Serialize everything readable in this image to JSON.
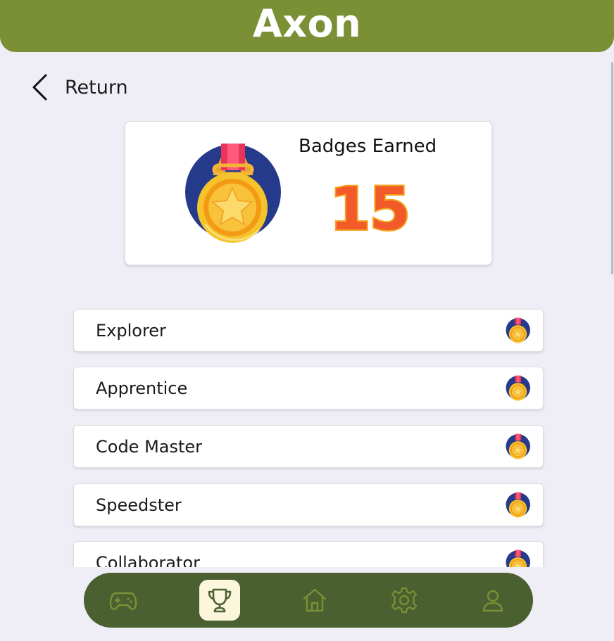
{
  "app": {
    "title": "Axon"
  },
  "nav_back": {
    "label": "Return",
    "icon": "chevron-left-icon"
  },
  "summary": {
    "title": "Badges Earned",
    "count": "15",
    "icon": "medal-icon"
  },
  "badges": [
    {
      "name": "Explorer",
      "icon": "medal-icon"
    },
    {
      "name": "Apprentice",
      "icon": "medal-icon"
    },
    {
      "name": "Code Master",
      "icon": "medal-icon"
    },
    {
      "name": "Speedster",
      "icon": "medal-icon"
    },
    {
      "name": "Collaborator",
      "icon": "medal-icon"
    }
  ],
  "bottom_nav": {
    "items": [
      {
        "icon": "gamepad-icon",
        "active": false
      },
      {
        "icon": "trophy-icon",
        "active": true
      },
      {
        "icon": "home-icon",
        "active": false
      },
      {
        "icon": "gear-icon",
        "active": false
      },
      {
        "icon": "user-icon",
        "active": false
      }
    ]
  },
  "colors": {
    "header": "#7b9035",
    "nav_bar": "#4a6030",
    "nav_icon": "#7b9035",
    "nav_active_bg": "#fbf6dc",
    "count_fill": "#f25a2a",
    "count_stroke": "#f6a41d",
    "background": "#efeef6"
  }
}
